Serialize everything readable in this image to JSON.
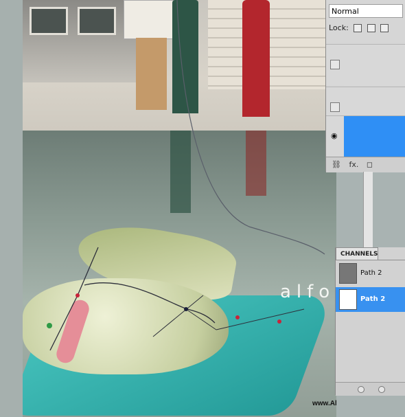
{
  "layers_panel": {
    "blend_mode": "Normal",
    "lock_label": "Lock:",
    "footer_links": "fx.",
    "icon_names": [
      "lock-transparent-icon",
      "brush-icon",
      "move-icon",
      "link-icon",
      "fx-icon"
    ]
  },
  "channels_panel": {
    "tab_label": "CHANNELS",
    "rows": [
      {
        "label": "Path 2"
      },
      {
        "label": "Path 2"
      }
    ]
  },
  "canvas": {
    "watermark_text": "alfo",
    "site": "www.Alfoart.com"
  },
  "colors": {
    "selection": "#3891f0",
    "panel_bg": "#d6d6d6"
  }
}
